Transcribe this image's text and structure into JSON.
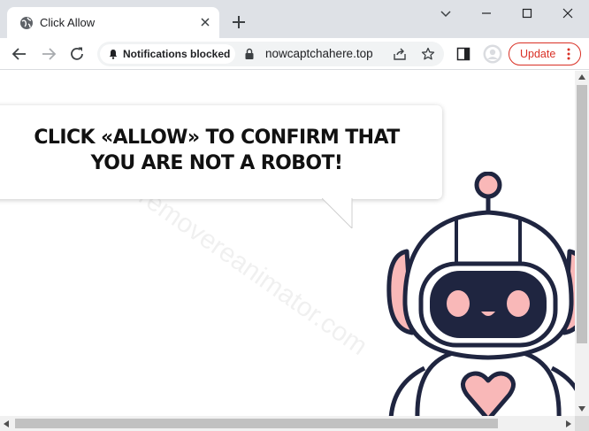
{
  "tab": {
    "title": "Click Allow",
    "favicon": "globe-icon"
  },
  "toolbar": {
    "notification_chip": "Notifications blocked",
    "url": "nowcaptchahere.top",
    "update_label": "Update"
  },
  "page": {
    "headline": "CLICK «ALLOW» TO CONFIRM THAT YOU ARE NOT A ROBOT!",
    "watermark": "removereanimator.com"
  },
  "colors": {
    "update_red": "#d93025",
    "robot_navy": "#1f2540",
    "robot_pink": "#f9b8b8",
    "titlebar_gray": "#dee1e6"
  }
}
